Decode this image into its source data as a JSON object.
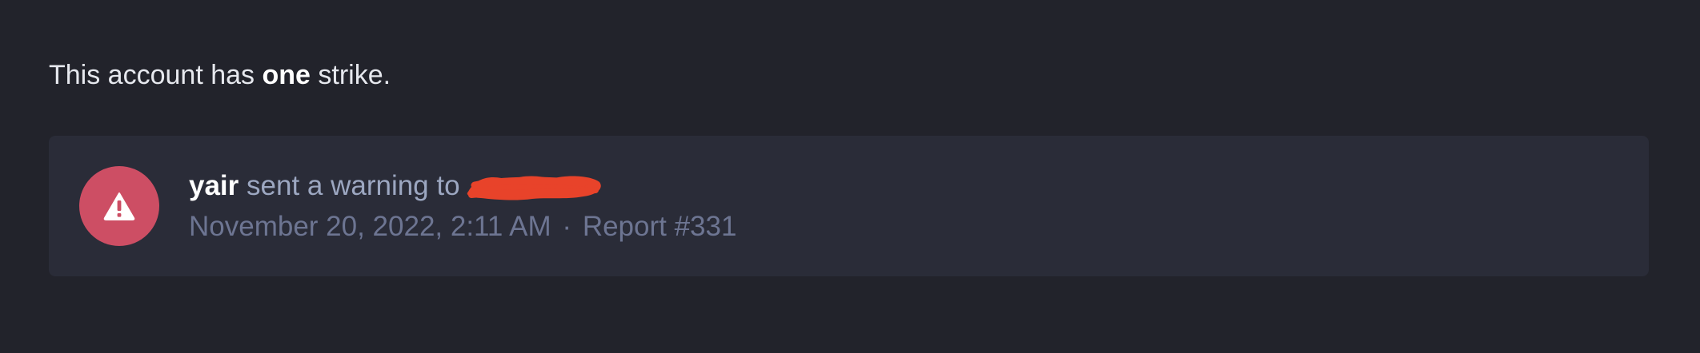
{
  "summary": {
    "prefix": "This account has",
    "count": "one",
    "suffix": "strike."
  },
  "strike": {
    "icon": "warning-triangle-icon",
    "badge_color": "#cd4e64",
    "actor": "yair",
    "action": "sent a warning to",
    "target_redacted": true,
    "date": "November 20, 2022, 2:11 AM",
    "separator": "·",
    "report": "Report #331"
  }
}
